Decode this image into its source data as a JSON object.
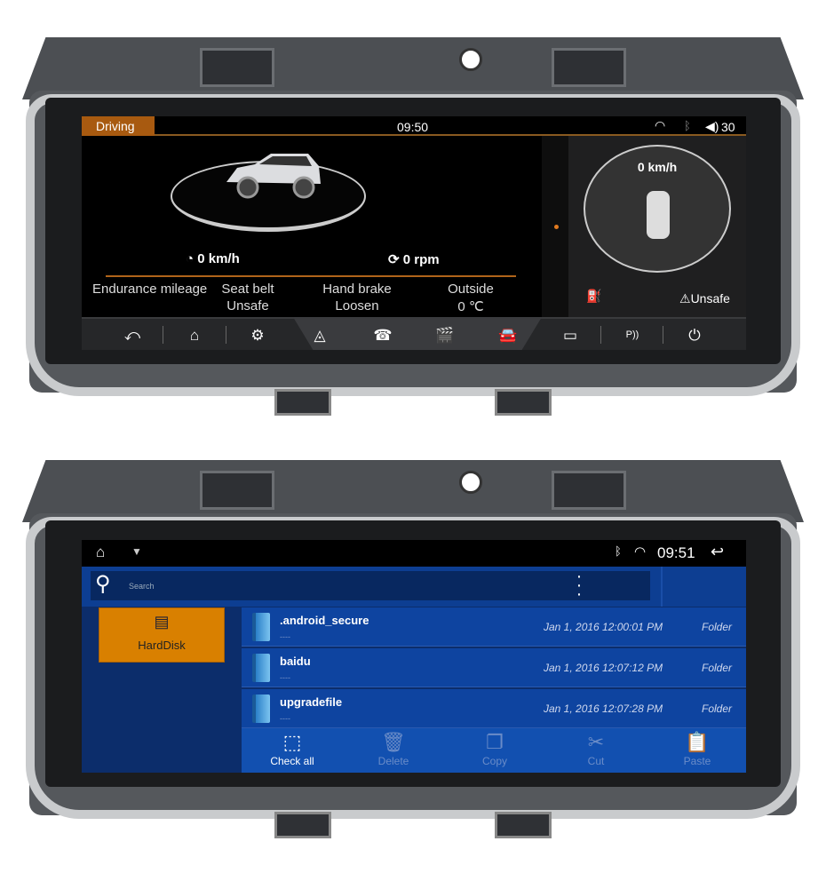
{
  "screen1": {
    "mode_tab": "Driving",
    "time": "09:50",
    "volume": "30",
    "speed": "0 km/h",
    "rpm": "0 rpm",
    "info": [
      {
        "label": "Endurance mileage",
        "value": ""
      },
      {
        "label": "Seat belt",
        "value": "Unsafe"
      },
      {
        "label": "Hand brake",
        "value": "Loosen"
      },
      {
        "label": "Outside",
        "value": "0 ℃"
      }
    ],
    "right_speed": "0 km/h",
    "seatbelt_status": "Unsafe",
    "nav": [
      {
        "icon": "back-icon",
        "glyph": "⤺"
      },
      {
        "icon": "home-icon",
        "glyph": "⌂"
      },
      {
        "icon": "settings-icon",
        "glyph": "⚙"
      },
      {
        "icon": "navigation-icon",
        "glyph": "◬"
      },
      {
        "icon": "phone-icon",
        "glyph": "☎"
      },
      {
        "icon": "media-icon",
        "glyph": "🎬"
      },
      {
        "icon": "car-icon",
        "glyph": "🚘"
      },
      {
        "icon": "camera-icon",
        "glyph": "▭"
      },
      {
        "icon": "parking-sensor-icon",
        "glyph": "P))"
      },
      {
        "icon": "power-icon",
        "glyph": "⏻"
      }
    ],
    "accent": "#a85a10"
  },
  "screen2": {
    "time": "09:51",
    "search_placeholder": "Search",
    "sidebar": {
      "label": "HardDisk"
    },
    "files": [
      {
        "name": ".android_secure",
        "sub": "----",
        "date": "Jan 1, 2016 12:00:01 PM",
        "type": "Folder"
      },
      {
        "name": "baidu",
        "sub": "----",
        "date": "Jan 1, 2016 12:07:12 PM",
        "type": "Folder"
      },
      {
        "name": "upgradefile",
        "sub": "----",
        "date": "Jan 1, 2016 12:07:28 PM",
        "type": "Folder"
      }
    ],
    "toolbar": [
      {
        "label": "Check all",
        "icon": "check-all-icon",
        "glyph": "⬚",
        "enabled": true
      },
      {
        "label": "Delete",
        "icon": "trash-icon",
        "glyph": "🗑",
        "enabled": false
      },
      {
        "label": "Copy",
        "icon": "copy-icon",
        "glyph": "❐",
        "enabled": false
      },
      {
        "label": "Cut",
        "icon": "scissors-icon",
        "glyph": "✂",
        "enabled": false
      },
      {
        "label": "Paste",
        "icon": "clipboard-icon",
        "glyph": "📋",
        "enabled": false
      }
    ],
    "accent": "#d98000"
  }
}
